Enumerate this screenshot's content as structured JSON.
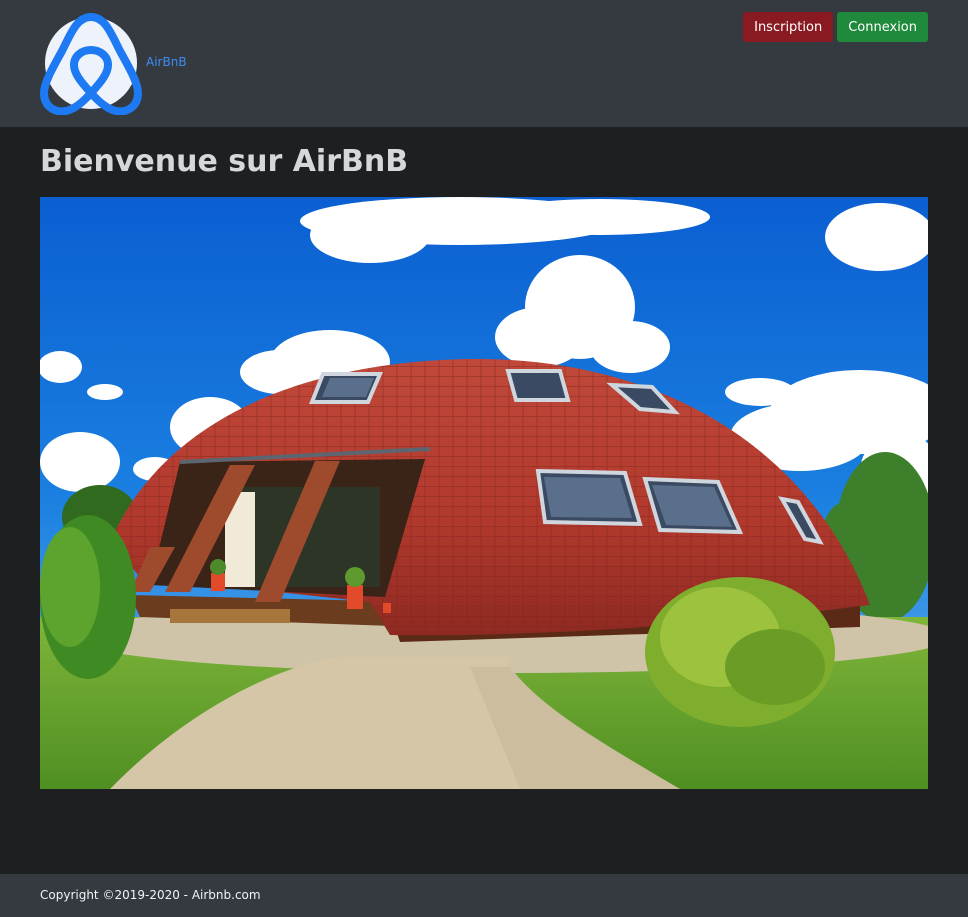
{
  "header": {
    "brand_name": "AirBnB",
    "signup_label": "Inscription",
    "login_label": "Connexion"
  },
  "main": {
    "title": "Bienvenue sur AirBnB"
  },
  "footer": {
    "copyright": "Copyright ©2019-2020 - Airbnb.com"
  },
  "colors": {
    "header_bg": "#343a40",
    "page_bg": "#1e1f21",
    "brand_blue": "#3d8ef5",
    "signup_red": "#8a1a22",
    "login_green": "#1f8a3c"
  },
  "icons": {
    "logo": "airbnb-logo-icon"
  }
}
